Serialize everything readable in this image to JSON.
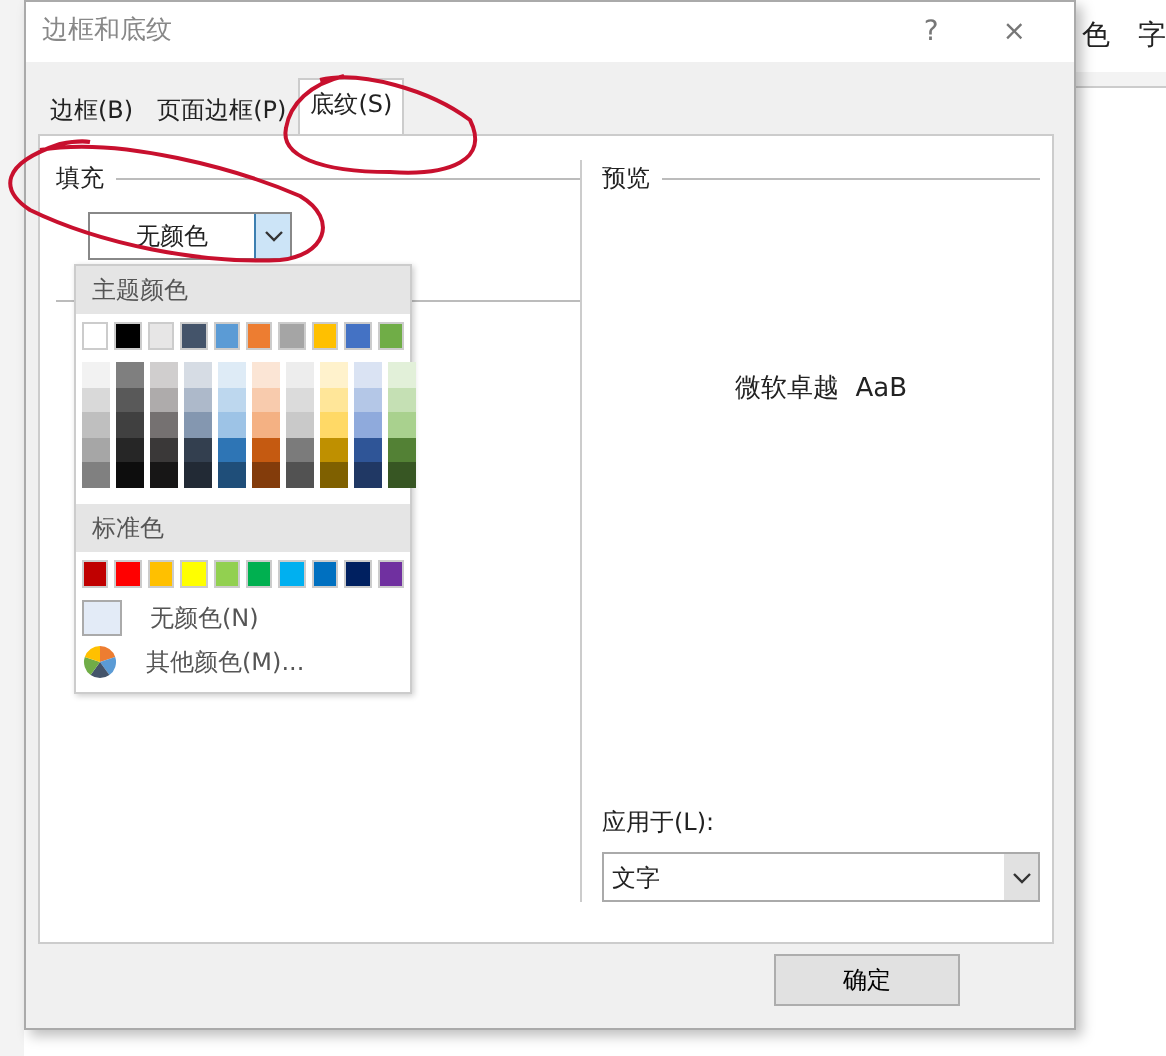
{
  "window": {
    "title": "边框和底纹",
    "help": "?",
    "close": "×"
  },
  "background_ribbon": {
    "items": [
      "色",
      "字"
    ]
  },
  "tabs": [
    {
      "label": "边框(B)",
      "selected": false
    },
    {
      "label": "页面边框(P)",
      "selected": false
    },
    {
      "label": "底纹(S)",
      "selected": true
    }
  ],
  "fill": {
    "label": "填充",
    "value": "无颜色",
    "expanded": true
  },
  "color_menu": {
    "theme_heading": "主题颜色",
    "theme_colors": [
      {
        "color": "#ffffff",
        "shades": [
          {
            "color": "#f2f2f2"
          },
          {
            "color": "#d9d9d9"
          },
          {
            "color": "#bfbfbf"
          },
          {
            "color": "#a6a6a6"
          },
          {
            "color": "#808080"
          }
        ]
      },
      {
        "color": "#000000",
        "shades": [
          {
            "color": "#7f7f7f"
          },
          {
            "color": "#595959"
          },
          {
            "color": "#404040"
          },
          {
            "color": "#262626"
          },
          {
            "color": "#0d0d0d"
          }
        ]
      },
      {
        "color": "#e7e6e6",
        "shades": [
          {
            "color": "#d0cece"
          },
          {
            "color": "#aeabab"
          },
          {
            "color": "#757171"
          },
          {
            "color": "#3a3838"
          },
          {
            "color": "#171616"
          }
        ]
      },
      {
        "color": "#44546a",
        "shades": [
          {
            "color": "#d6dce4"
          },
          {
            "color": "#adb9ca"
          },
          {
            "color": "#8497b0"
          },
          {
            "color": "#333f4f"
          },
          {
            "color": "#222a35"
          }
        ]
      },
      {
        "color": "#5b9bd5",
        "shades": [
          {
            "color": "#deebf6"
          },
          {
            "color": "#bdd7ee"
          },
          {
            "color": "#9dc3e6"
          },
          {
            "color": "#2e75b5"
          },
          {
            "color": "#1f4e79"
          }
        ]
      },
      {
        "color": "#ed7d31",
        "shades": [
          {
            "color": "#fbe5d5"
          },
          {
            "color": "#f8cbad"
          },
          {
            "color": "#f4b183"
          },
          {
            "color": "#c55a11"
          },
          {
            "color": "#833c0b"
          }
        ]
      },
      {
        "color": "#a5a5a5",
        "shades": [
          {
            "color": "#ededed"
          },
          {
            "color": "#dbdbdb"
          },
          {
            "color": "#c9c9c9"
          },
          {
            "color": "#7b7b7b"
          },
          {
            "color": "#525252"
          }
        ]
      },
      {
        "color": "#ffc000",
        "shades": [
          {
            "color": "#fff2cc"
          },
          {
            "color": "#ffe699"
          },
          {
            "color": "#ffd966"
          },
          {
            "color": "#bf9000"
          },
          {
            "color": "#7f6000"
          }
        ]
      },
      {
        "color": "#4472c4",
        "shades": [
          {
            "color": "#dae3f3"
          },
          {
            "color": "#b4c7e7"
          },
          {
            "color": "#8faadc"
          },
          {
            "color": "#2f5597"
          },
          {
            "color": "#203864"
          }
        ]
      },
      {
        "color": "#70ad47",
        "shades": [
          {
            "color": "#e2f0d9"
          },
          {
            "color": "#c5e0b4"
          },
          {
            "color": "#a9d18e"
          },
          {
            "color": "#538135"
          },
          {
            "color": "#375623"
          }
        ]
      }
    ],
    "standard_heading": "标准色",
    "standard_colors": [
      {
        "color": "#c00000"
      },
      {
        "color": "#ff0000"
      },
      {
        "color": "#ffc000"
      },
      {
        "color": "#ffff00"
      },
      {
        "color": "#92d050"
      },
      {
        "color": "#00b050"
      },
      {
        "color": "#00b0f0"
      },
      {
        "color": "#0070c0"
      },
      {
        "color": "#002060"
      },
      {
        "color": "#7030a0"
      }
    ],
    "no_color": "无颜色(N)",
    "more_colors": "其他颜色(M)..."
  },
  "preview": {
    "label": "预览",
    "sample": "微软卓越  AaB"
  },
  "apply_to": {
    "label": "应用于(L):",
    "value": "文字"
  },
  "buttons": [
    "确定"
  ]
}
